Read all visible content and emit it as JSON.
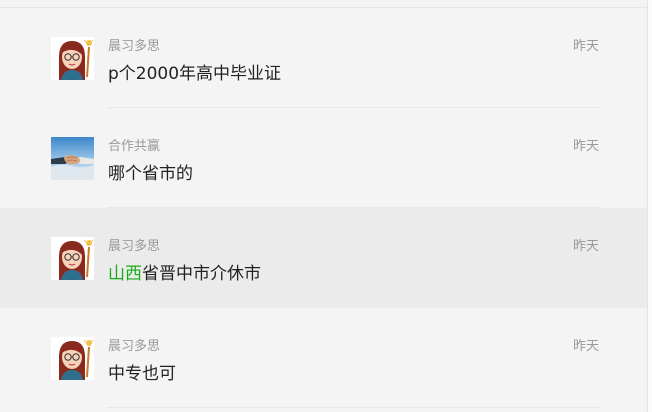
{
  "messages": [
    {
      "sender": "晨习多思",
      "time": "昨天",
      "text": "p个2000年高中毕业证",
      "avatar": "girl-cartoon-avatar",
      "highlighted": false
    },
    {
      "sender": "合作共赢",
      "time": "昨天",
      "text": "哪个省市的",
      "avatar": "handshake-avatar",
      "highlighted": false
    },
    {
      "sender": "晨习多思",
      "time": "昨天",
      "text_highlight": "山西",
      "text_rest": "省晋中市介休市",
      "avatar": "girl-cartoon-avatar",
      "highlighted": true
    },
    {
      "sender": "晨习多思",
      "time": "昨天",
      "text": "中专也可",
      "avatar": "girl-cartoon-avatar",
      "highlighted": false
    }
  ],
  "colors": {
    "background": "#f4f4f4",
    "highlight_row": "#ebebeb",
    "meta_text": "#999999",
    "body_text": "#222222",
    "keyword_green": "#1aad19"
  }
}
